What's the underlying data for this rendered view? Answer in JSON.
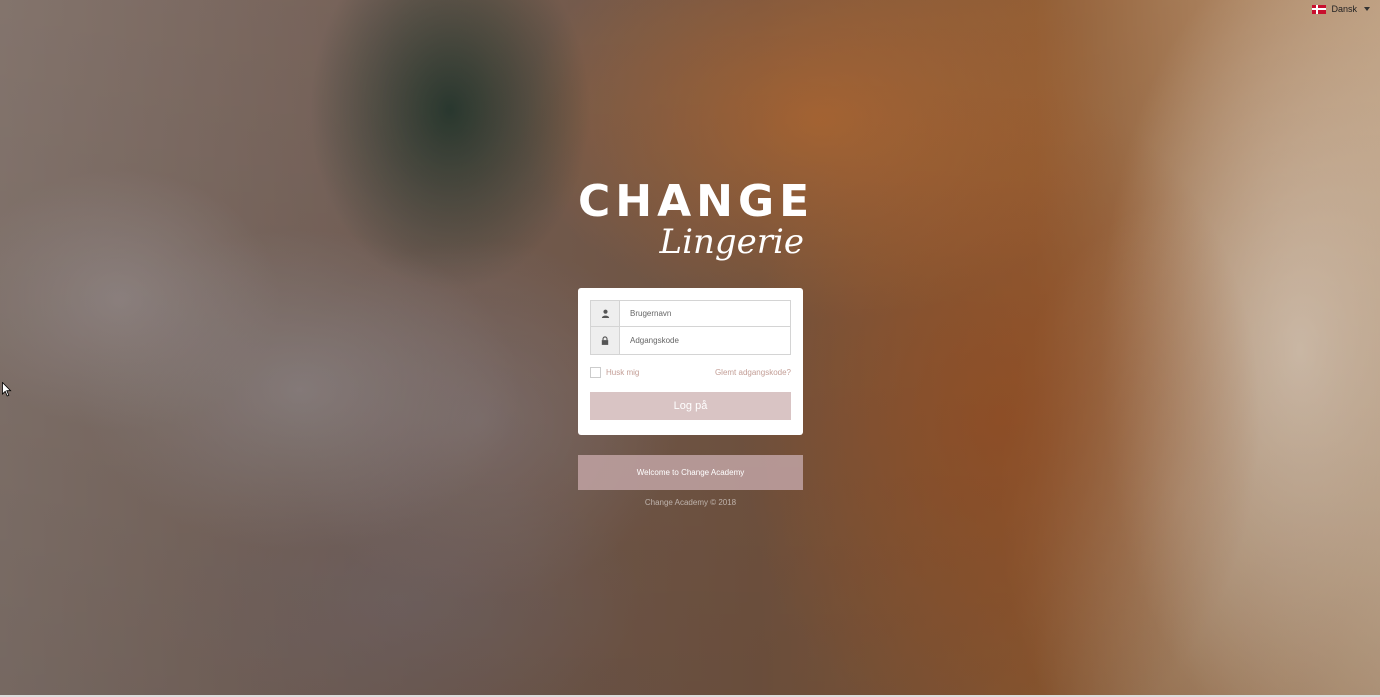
{
  "language": {
    "label": "Dansk",
    "flag_icon": "denmark-flag-icon"
  },
  "brand": {
    "main": "CHANGE",
    "script": "Lingerie"
  },
  "login": {
    "username_placeholder": "Brugernavn",
    "password_placeholder": "Adgangskode",
    "remember_label": "Husk mig",
    "forgot_label": "Glemt adgangskode?",
    "submit_label": "Log på"
  },
  "welcome": {
    "text": "Welcome to Change Academy"
  },
  "footer": {
    "copyright": "Change Academy © 2018"
  },
  "colors": {
    "accent_pink": "#c39e96",
    "button_bg": "#d9c4c4",
    "welcome_bg": "#bfa0a0"
  }
}
